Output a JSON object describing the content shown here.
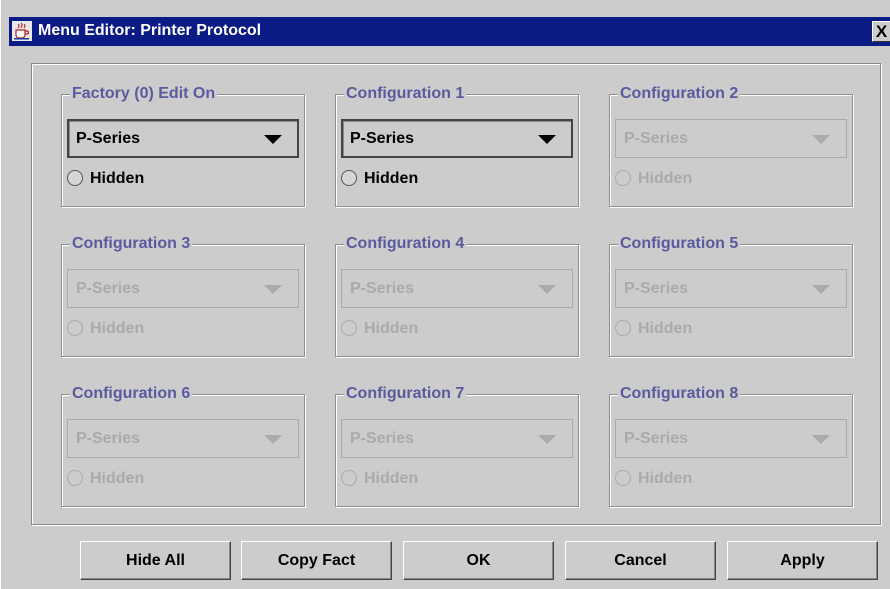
{
  "window": {
    "title": "Menu Editor: Printer Protocol",
    "close_label": "X"
  },
  "groups": [
    {
      "title": "Factory (0) Edit On",
      "selected": "P-Series",
      "radio_label": "Hidden",
      "enabled": true
    },
    {
      "title": "Configuration 1",
      "selected": "P-Series",
      "radio_label": "Hidden",
      "enabled": true
    },
    {
      "title": "Configuration 2",
      "selected": "P-Series",
      "radio_label": "Hidden",
      "enabled": false
    },
    {
      "title": "Configuration 3",
      "selected": "P-Series",
      "radio_label": "Hidden",
      "enabled": false
    },
    {
      "title": "Configuration 4",
      "selected": "P-Series",
      "radio_label": "Hidden",
      "enabled": false
    },
    {
      "title": "Configuration 5",
      "selected": "P-Series",
      "radio_label": "Hidden",
      "enabled": false
    },
    {
      "title": "Configuration 6",
      "selected": "P-Series",
      "radio_label": "Hidden",
      "enabled": false
    },
    {
      "title": "Configuration 7",
      "selected": "P-Series",
      "radio_label": "Hidden",
      "enabled": false
    },
    {
      "title": "Configuration 8",
      "selected": "P-Series",
      "radio_label": "Hidden",
      "enabled": false
    }
  ],
  "buttons": {
    "hide_all": "Hide All",
    "copy_fact": "Copy Fact",
    "ok": "OK",
    "cancel": "Cancel",
    "apply": "Apply"
  },
  "colors": {
    "titlebar": "#0a1b86",
    "group_title": "#5a5a9e",
    "disabled_text": "#aaaaaa",
    "window_bg": "#cccccc"
  },
  "icons": {
    "app": "java-coffee-cup-icon",
    "combo_arrow": "triangle-down-icon",
    "radio": "radio-unchecked-icon"
  }
}
